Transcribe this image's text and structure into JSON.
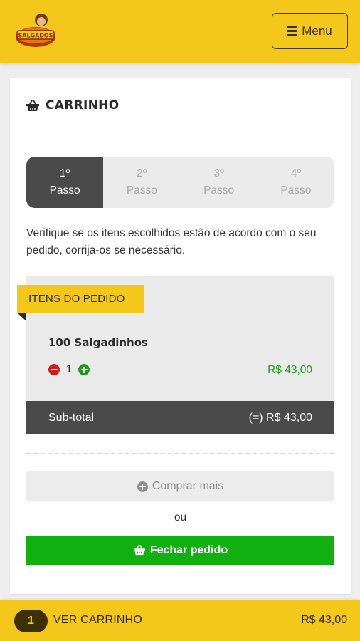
{
  "brand": {
    "logo_text": "SALGADOS"
  },
  "header": {
    "menu_label": "Menu"
  },
  "cart": {
    "title": "CARRINHO",
    "steps": [
      {
        "line1": "1º",
        "line2": "Passo",
        "active": true
      },
      {
        "line1": "2º",
        "line2": "Passo",
        "active": false
      },
      {
        "line1": "3º",
        "line2": "Passo",
        "active": false
      },
      {
        "line1": "4º",
        "line2": "Passo",
        "active": false
      }
    ],
    "intro": "Verifique se os itens escolhidos estão de acordo com o seu pedido, corrija-os se necessário.",
    "section_label": "ITENS DO PEDIDO",
    "items": [
      {
        "name": "100 Salgadinhos",
        "quantity": "1",
        "price": "R$ 43,00"
      }
    ],
    "subtotal_label": "Sub-total",
    "subtotal_value": "(=) R$ 43,00",
    "buy_more_label": "Comprar mais",
    "or_label": "ou",
    "checkout_label": "Fechar pedido"
  },
  "bottom_bar": {
    "count": "1",
    "label": "VER CARRINHO",
    "total": "R$ 43,00"
  },
  "colors": {
    "brand_yellow": "#f4c81b",
    "dark_gray": "#4a4a4a",
    "success_green": "#0fb00f",
    "price_green": "#1aa51a",
    "minus_red": "#d11b1b"
  },
  "icons": [
    "hamburger-icon",
    "basket-icon",
    "minus-circle-icon",
    "plus-circle-icon"
  ]
}
